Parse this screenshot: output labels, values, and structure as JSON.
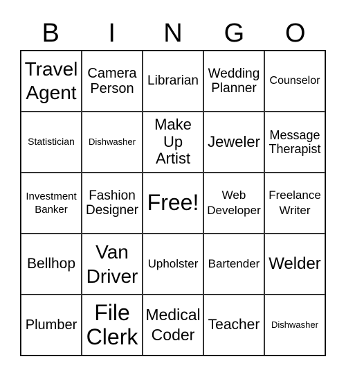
{
  "header": [
    "B",
    "I",
    "N",
    "G",
    "O"
  ],
  "cells": [
    "Travel Agent",
    "Camera Person",
    "Librarian",
    "Wedding Planner",
    "Counselor",
    "Statistician",
    "Dishwasher",
    "Make Up Artist",
    "Jeweler",
    "Message Therapist",
    "Investment Banker",
    "Fashion Designer",
    "Free!",
    "Web Developer",
    "Freelance Writer",
    "Bellhop",
    "Van Driver",
    "Upholster",
    "Bartender",
    "Welder",
    "Plumber",
    "File Clerk",
    "Medical Coder",
    "Teacher",
    "Dishwasher"
  ]
}
